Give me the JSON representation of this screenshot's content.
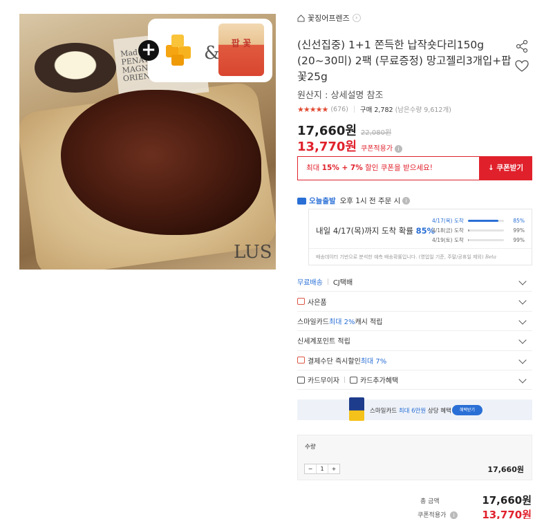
{
  "store": {
    "name": "꽃징어프렌즈",
    "home_icon": "home-icon",
    "arrow_icon": "chevron-right-icon"
  },
  "product": {
    "title": "(신선집중) 1+1 쫀득한 납작숏다리150g (20~30미) 2팩 (무료증정) 망고젤리3개입+팝꽃25g",
    "origin": "원산지 : 상세설명 참조",
    "rating_count": "(676)",
    "purchase": "구매 2,782",
    "stock": "(남은수량 9,612개)",
    "price": "17,660원",
    "original_price": "22,080원",
    "coupon_price": "13,770원",
    "coupon_label": "쿠폰적용가",
    "rating": 4.5
  },
  "image": {
    "amp": "&",
    "plus": "+",
    "pack_label": "팝 꽃",
    "book_text": "Mad\nPENATI BUSET\nMAGNIS SAIRT\nORIENT OITES",
    "lus": "LUS"
  },
  "coupon": {
    "prefix": "최대 ",
    "highlight": "15% + 7%",
    "suffix": " 할인 쿠폰을 받으세요!",
    "button": "↓ 쿠폰받기"
  },
  "delivery": {
    "badge": "오늘출발",
    "text": "오후 1시 전 주문 시",
    "main_prefix": "내일 4/17(목)까지 도착 확률 ",
    "main_pct": "85%",
    "rows": [
      {
        "label": "4/17(목) 도착",
        "value": "85%",
        "pct": 0.85
      },
      {
        "label": "4/18(금) 도착",
        "value": "99%",
        "pct": 0.04
      },
      {
        "label": "4/19(토) 도착",
        "value": "99%",
        "pct": 0.01
      }
    ],
    "note": "배송데이터 기반으로 분석한 예측 배송확률입니다. (영업일 기준, 주말/공휴일 제외)",
    "beta": "Beta"
  },
  "list": {
    "shipping_free": "무료배송",
    "shipping_co": "CJ택배",
    "gift": "사은품",
    "smile_prefix": "스마일카드 ",
    "smile_highlight": "최대 2%",
    "smile_suffix": " 캐시 적립",
    "point": "신세계포인트 적립",
    "pay_prefix": "결제수단 즉시할인 ",
    "pay_highlight": "최대 7%",
    "card_interest": "카드무이자",
    "card_extra": "카드추가혜택"
  },
  "banner": {
    "prefix": "스마일카드 ",
    "highlight": "최대 6만원",
    "suffix": " 상당 혜택",
    "button": "혜택받기"
  },
  "quantity": {
    "label": "수량",
    "minus": "−",
    "value": "1",
    "plus": "+",
    "price": "17,660원"
  },
  "total": {
    "label": "총 금액",
    "value": "17,660원",
    "coupon_label": "쿠폰적용가",
    "coupon_value": "13,770원"
  },
  "colors": {
    "accent_red": "#e0212c",
    "accent_blue": "#2a6fd6",
    "star": "#e04a32"
  }
}
